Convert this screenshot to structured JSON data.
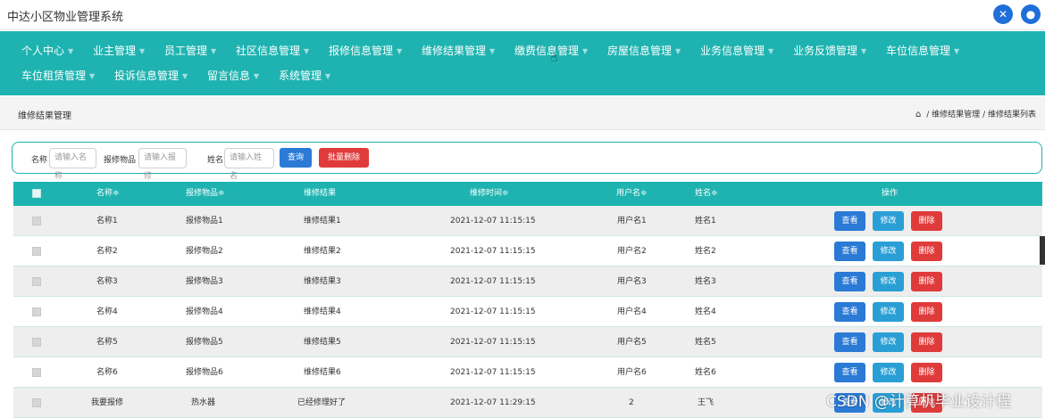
{
  "app": {
    "title": "中达小区物业管理系统"
  },
  "topbar": {
    "icon1": "settings-cross-icon",
    "icon2": "user-icon"
  },
  "nav": {
    "row1": [
      "个人中心",
      "业主管理",
      "员工管理",
      "社区信息管理",
      "报修信息管理",
      "维修结果管理",
      "缴费信息管理",
      "房屋信息管理",
      "业务信息管理",
      "业务反馈管理",
      "车位信息管理"
    ],
    "row2": [
      "车位租赁管理",
      "投诉信息管理",
      "留言信息",
      "系统管理"
    ]
  },
  "page": {
    "title": "维修结果管理",
    "breadcrumb": {
      "home_icon": "home-icon",
      "sep": "/",
      "level1": "维修结果管理",
      "level2": "维修结果列表"
    }
  },
  "search": {
    "name_label": "名称",
    "name_placeholder": "请输入名称",
    "item_label": "报修物品",
    "item_placeholder": "请输入报修",
    "person_label": "姓名",
    "person_placeholder": "请输入姓名",
    "query_label": "查询",
    "batch_delete_label": "批量删除"
  },
  "table": {
    "headers": [
      "名称≑",
      "报修物品≑",
      "维修结果",
      "维修时间≑",
      "用户名≑",
      "姓名≑",
      "操作"
    ],
    "actions": {
      "view": "查看",
      "edit": "修改",
      "delete": "删除"
    },
    "rows": [
      [
        "名称1",
        "报修物品1",
        "维修结果1",
        "2021-12-07 11:15:15",
        "用户名1",
        "姓名1"
      ],
      [
        "名称2",
        "报修物品2",
        "维修结果2",
        "2021-12-07 11:15:15",
        "用户名2",
        "姓名2"
      ],
      [
        "名称3",
        "报修物品3",
        "维修结果3",
        "2021-12-07 11:15:15",
        "用户名3",
        "姓名3"
      ],
      [
        "名称4",
        "报修物品4",
        "维修结果4",
        "2021-12-07 11:15:15",
        "用户名4",
        "姓名4"
      ],
      [
        "名称5",
        "报修物品5",
        "维修结果5",
        "2021-12-07 11:15:15",
        "用户名5",
        "姓名5"
      ],
      [
        "名称6",
        "报修物品6",
        "维修结果6",
        "2021-12-07 11:15:15",
        "用户名6",
        "姓名6"
      ],
      [
        "我要报修",
        "热水器",
        "已经修理好了",
        "2021-12-07 11:29:15",
        "2",
        "王飞"
      ]
    ]
  },
  "watermark": "CSDN @计算机毕业设计程",
  "colors": {
    "primary": "#1eb3b0",
    "blue": "#2a7ad6",
    "red": "#e03b3b"
  }
}
